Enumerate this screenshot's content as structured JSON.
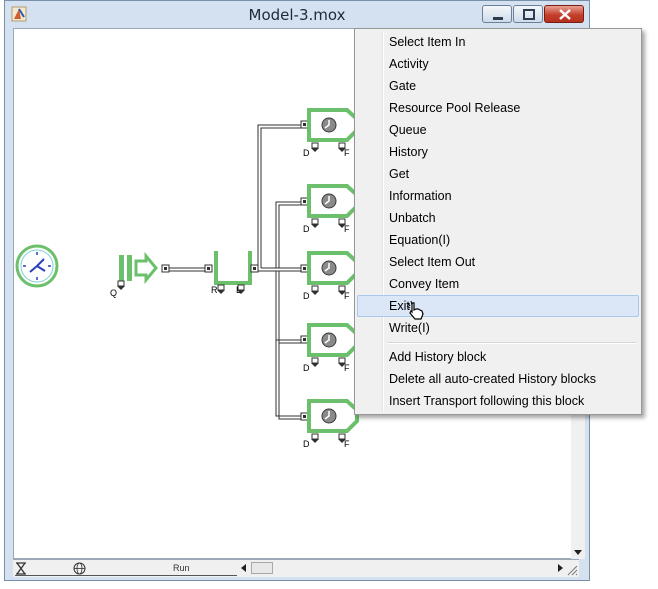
{
  "window": {
    "title": "Model-3.mox"
  },
  "statusbar": {
    "run_label": "Run"
  },
  "model": {
    "port_d": "D",
    "port_f": "F",
    "port_q": "Q",
    "port_r": "R",
    "port_l": "L"
  },
  "context_menu": {
    "items": [
      "Select Item In",
      "Activity",
      "Gate",
      "Resource Pool Release",
      "Queue",
      "History",
      "Get",
      "Information",
      "Unbatch",
      "Equation(I)",
      "Select Item Out",
      "Convey Item",
      "Exit",
      "Write(I)"
    ],
    "highlighted": "Exit",
    "extra_items": [
      "Add History block",
      "Delete all auto-created History blocks",
      "Insert Transport following this block"
    ]
  },
  "colors": {
    "block_green": "#6cc06c",
    "highlight_bg": "#dbe7f6",
    "close_red": "#c4402c",
    "clock_blue": "#2a3fc0"
  },
  "icons": [
    "app-icon",
    "minimize-icon",
    "maximize-icon",
    "close-icon",
    "hourglass-icon",
    "globe-icon",
    "pointer-cursor-icon",
    "resize-grip-icon"
  ]
}
